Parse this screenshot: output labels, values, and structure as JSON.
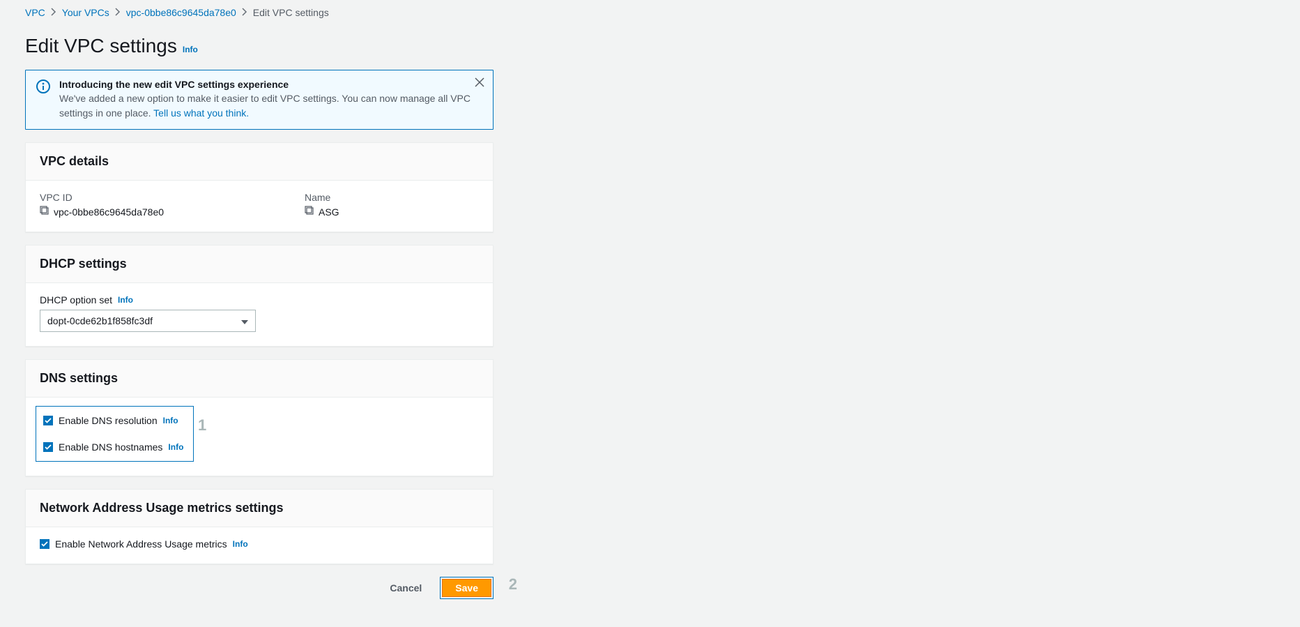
{
  "breadcrumb": {
    "items": [
      {
        "label": "VPC",
        "link": true
      },
      {
        "label": "Your VPCs",
        "link": true
      },
      {
        "label": "vpc-0bbe86c9645da78e0",
        "link": true
      },
      {
        "label": "Edit VPC settings",
        "link": false
      }
    ]
  },
  "page": {
    "title": "Edit VPC settings",
    "info": "Info"
  },
  "banner": {
    "title": "Introducing the new edit VPC settings experience",
    "text_pre": "We've added a new option to make it easier to edit VPC settings. You can now manage all VPC settings in one place. ",
    "link": "Tell us what you think."
  },
  "details": {
    "title": "VPC details",
    "vpc_id_label": "VPC ID",
    "vpc_id_value": "vpc-0bbe86c9645da78e0",
    "name_label": "Name",
    "name_value": "ASG"
  },
  "dhcp": {
    "title": "DHCP settings",
    "label": "DHCP option set",
    "info": "Info",
    "selected": "dopt-0cde62b1f858fc3df"
  },
  "dns": {
    "title": "DNS settings",
    "resolution_label": "Enable DNS resolution",
    "resolution_info": "Info",
    "hostnames_label": "Enable DNS hostnames",
    "hostnames_info": "Info"
  },
  "nau": {
    "title": "Network Address Usage metrics settings",
    "label": "Enable Network Address Usage metrics",
    "info": "Info"
  },
  "actions": {
    "cancel": "Cancel",
    "save": "Save"
  },
  "annotations": {
    "one": "1",
    "two": "2"
  }
}
